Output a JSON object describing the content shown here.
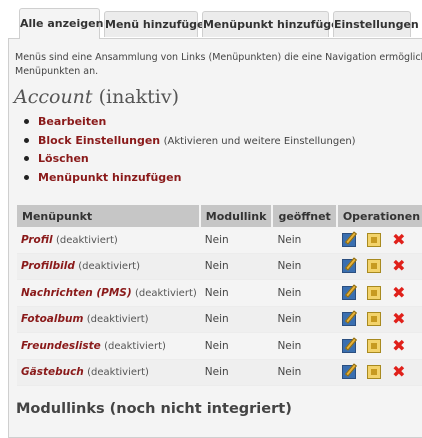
{
  "tabs": [
    {
      "label": "Alle anzeigen",
      "active": true
    },
    {
      "label": "Menü hinzufügen",
      "active": false
    },
    {
      "label": "Menüpunkt hinzufügen",
      "active": false
    },
    {
      "label": "Einstellungen",
      "active": false
    }
  ],
  "intro": {
    "line1": "Menüs sind eine Ansammlung von Links (Menüpunkten) die eine Navigation ermögliche",
    "line2": "Menüpunkten an."
  },
  "menu_title": {
    "name": "Account",
    "status": "(inaktiv)"
  },
  "actions": [
    {
      "label": "Bearbeiten",
      "note": ""
    },
    {
      "label": "Block Einstellungen",
      "note": "(Aktivieren und weitere Einstellungen)"
    },
    {
      "label": "Löschen",
      "note": ""
    },
    {
      "label": "Menüpunkt hinzufügen",
      "note": ""
    }
  ],
  "table": {
    "headers": [
      "Menüpunkt",
      "Modullink",
      "geöffnet",
      "Operationen"
    ],
    "rows": [
      {
        "name": "Profil",
        "status": "(deaktiviert)",
        "modullink": "Nein",
        "open": "Nein"
      },
      {
        "name": "Profilbild",
        "status": "(deaktiviert)",
        "modullink": "Nein",
        "open": "Nein"
      },
      {
        "name": "Nachrichten (PMS)",
        "status": "(deaktiviert)",
        "modullink": "Nein",
        "open": "Nein"
      },
      {
        "name": "Fotoalbum",
        "status": "(deaktiviert)",
        "modullink": "Nein",
        "open": "Nein"
      },
      {
        "name": "Freundesliste",
        "status": "(deaktiviert)",
        "modullink": "Nein",
        "open": "Nein"
      },
      {
        "name": "Gästebuch",
        "status": "(deaktiviert)",
        "modullink": "Nein",
        "open": "Nein"
      }
    ],
    "operation_icons": [
      "edit-icon",
      "properties-icon",
      "delete-icon"
    ]
  },
  "section_heading": "Modullinks (noch nicht integriert)",
  "colors": {
    "link": "#8a1a1a",
    "panel": "#f4f4f4",
    "header": "#c6c6c6",
    "delete": "#e0201a"
  }
}
